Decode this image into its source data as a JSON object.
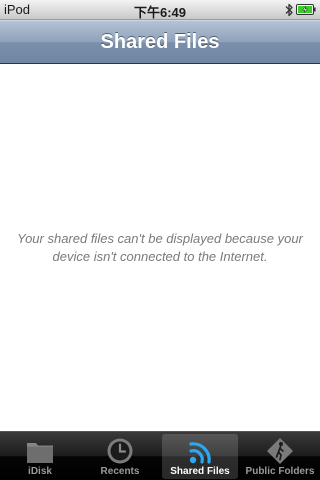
{
  "status_bar": {
    "carrier": "iPod",
    "time": "下午6:49"
  },
  "nav": {
    "title": "Shared Files"
  },
  "content": {
    "message": "Your shared files can't be displayed because your device isn't connected to the Internet."
  },
  "tabs": [
    {
      "label": "iDisk",
      "icon": "folder-icon",
      "active": false
    },
    {
      "label": "Recents",
      "icon": "clock-icon",
      "active": false
    },
    {
      "label": "Shared Files",
      "icon": "wifi-broadcast-icon",
      "active": true
    },
    {
      "label": "Public Folders",
      "icon": "person-walking-icon",
      "active": false
    }
  ],
  "colors": {
    "nav_bar": "#8ea1bb",
    "active_tab_icon": "#2aa8f2",
    "message_text": "#7a7a7a",
    "battery_fill": "#3ccc2c"
  }
}
